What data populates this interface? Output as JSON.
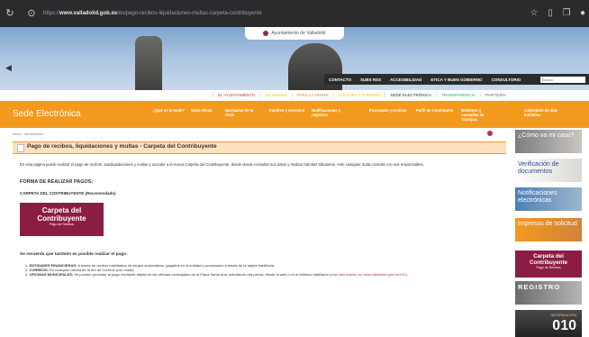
{
  "browser": {
    "url_prefix": "https://",
    "url_host": "www.valladolid.gob.es",
    "url_path": "/es/pago-recibos-liquidaciones-multas-carpeta-contribuyente"
  },
  "header": {
    "logo_text": "Ayuntamiento de Valladolid",
    "top_menu": [
      "CONTACTO",
      "SUBS RSS",
      "ACCESIBILIDAD",
      "ETICA Y BUEN GOBIERNO",
      "CONSULTORIO"
    ],
    "search_placeholder": "Buscar",
    "site_nav": [
      {
        "label": "EL AYUNTAMIENTO",
        "color": "#c0392b"
      },
      {
        "label": "TU CIUDAD",
        "color": "#e6b800"
      },
      {
        "label": "PARA LA GENTE",
        "color": "#e67e22"
      },
      {
        "label": "CULTURA Y TURISMO",
        "color": "#f1c40f"
      },
      {
        "label": "SEDE ELECTRÓNICA",
        "color": "#333333"
      },
      {
        "label": "TRANSPARENCIA",
        "color": "#27ae60"
      },
      {
        "label": "PARTICIPA",
        "color": "#8e44ad"
      }
    ]
  },
  "sede": {
    "title": "Sede Electrónica",
    "menu": [
      "¿Qué es la Sede?",
      "Sede oficial",
      "Normativa de la Sede",
      "Trámites y servicios",
      "Notificaciones y registros",
      "Procesado y Archivo",
      "Perfil de Contratante",
      "Boletines y consultas de Transpar.",
      "Calendario de días inhábiles"
    ]
  },
  "breadcrumb": "Inicio › Información",
  "page": {
    "title": "Pago de recibos, liquidaciones y multas - Carpeta del Contribuyente",
    "description": "En esta página puede realizar el pago de recibos, autoliquidaciones y multas y acceder a la nueva Carpeta del Contribuyente, desde donde consultar sus datos y realizar trámites tributarios. Ante cualquier duda consulte con sus responsables.",
    "forma_heading": "FORMA DE REALIZAR PAGOS:",
    "carpeta_heading": "CARPETA DEL CONTRIBUYENTE (Recomendado)",
    "carpeta_button": {
      "line1": "Carpeta del",
      "line2": "Contribuyente",
      "line3": "Pago de Recibos"
    },
    "also_heading": "Se recuerda que también es posible realizar el pago:",
    "options": [
      {
        "lead": "ENTIDADES FINANCIERAS:",
        "text": "A través de recibos habilitados de cargos automáticos, pagados en la entidad y procesados a través de la tarjeta habilitada."
      },
      {
        "lead": "CORREOS:",
        "text": "En cualquier oficina de la red de Correos (con coste)."
      },
      {
        "lead": "OFICINAS MUNICIPALES:",
        "text": "Se pueden proceder al pago mediante tarjeta en las oficinas municipales de la Plaza Santa Ana, solicitando cita previa, desde la web o en el teléfono habilitado",
        "link": "(más información en www.valladolid.gob.es/010)."
      }
    ]
  },
  "sidebar": [
    {
      "id": "s1",
      "label": "¿Cómo va mi caso?"
    },
    {
      "id": "s2",
      "label": "Verificación de documentos"
    },
    {
      "id": "s3",
      "label": "Notificaciones electrónicas"
    },
    {
      "id": "s4",
      "label": "Impresos de solicitud"
    },
    {
      "id": "s5",
      "line1": "Carpeta del",
      "line2": "Contribuyente",
      "line3": "Pago de Recibos"
    },
    {
      "id": "s6",
      "label": "REGISTRO"
    },
    {
      "id": "s7",
      "small": "INFORMACIÓN",
      "num": "010"
    }
  ]
}
